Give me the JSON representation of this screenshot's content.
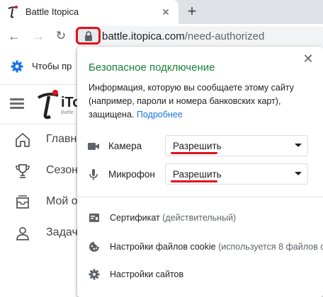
{
  "browser": {
    "tab_title": "Battle Itopica",
    "tab_close": "✕",
    "new_tab": "+",
    "url_host": "battle.itopica.com",
    "url_path": "/need-authorized"
  },
  "bookmarks": {
    "text": "Чтобы пр"
  },
  "site": {
    "logo_text": "iTo",
    "logo_sub": "Battle",
    "menu": [
      {
        "label": "Главн",
        "icon": "home-icon"
      },
      {
        "label": "Сезон",
        "icon": "trophy-icon"
      },
      {
        "label": "Мой о",
        "icon": "inbox-icon"
      },
      {
        "label": "Задач",
        "icon": "person-icon"
      }
    ]
  },
  "popup": {
    "title": "Безопасное подключение",
    "description": "Информация, которую вы сообщаете этому сайту (например, пароли и номера банковских карт), защищена.",
    "more_link": "Подробнее",
    "close": "✕",
    "permissions": [
      {
        "label": "Камера",
        "value": "Разрешить",
        "icon": "camera-icon"
      },
      {
        "label": "Микрофон",
        "value": "Разрешить",
        "icon": "microphone-icon"
      }
    ],
    "certificate_label": "Сертификат",
    "certificate_note": "(действительный)",
    "cookies_label": "Настройки файлов cookie",
    "cookies_note": "(используется 8 файлов с",
    "site_settings_label": "Настройки сайтов"
  },
  "colors": {
    "secure_green": "#188038",
    "link_blue": "#1a73e8",
    "highlight_red": "#e0121d"
  }
}
